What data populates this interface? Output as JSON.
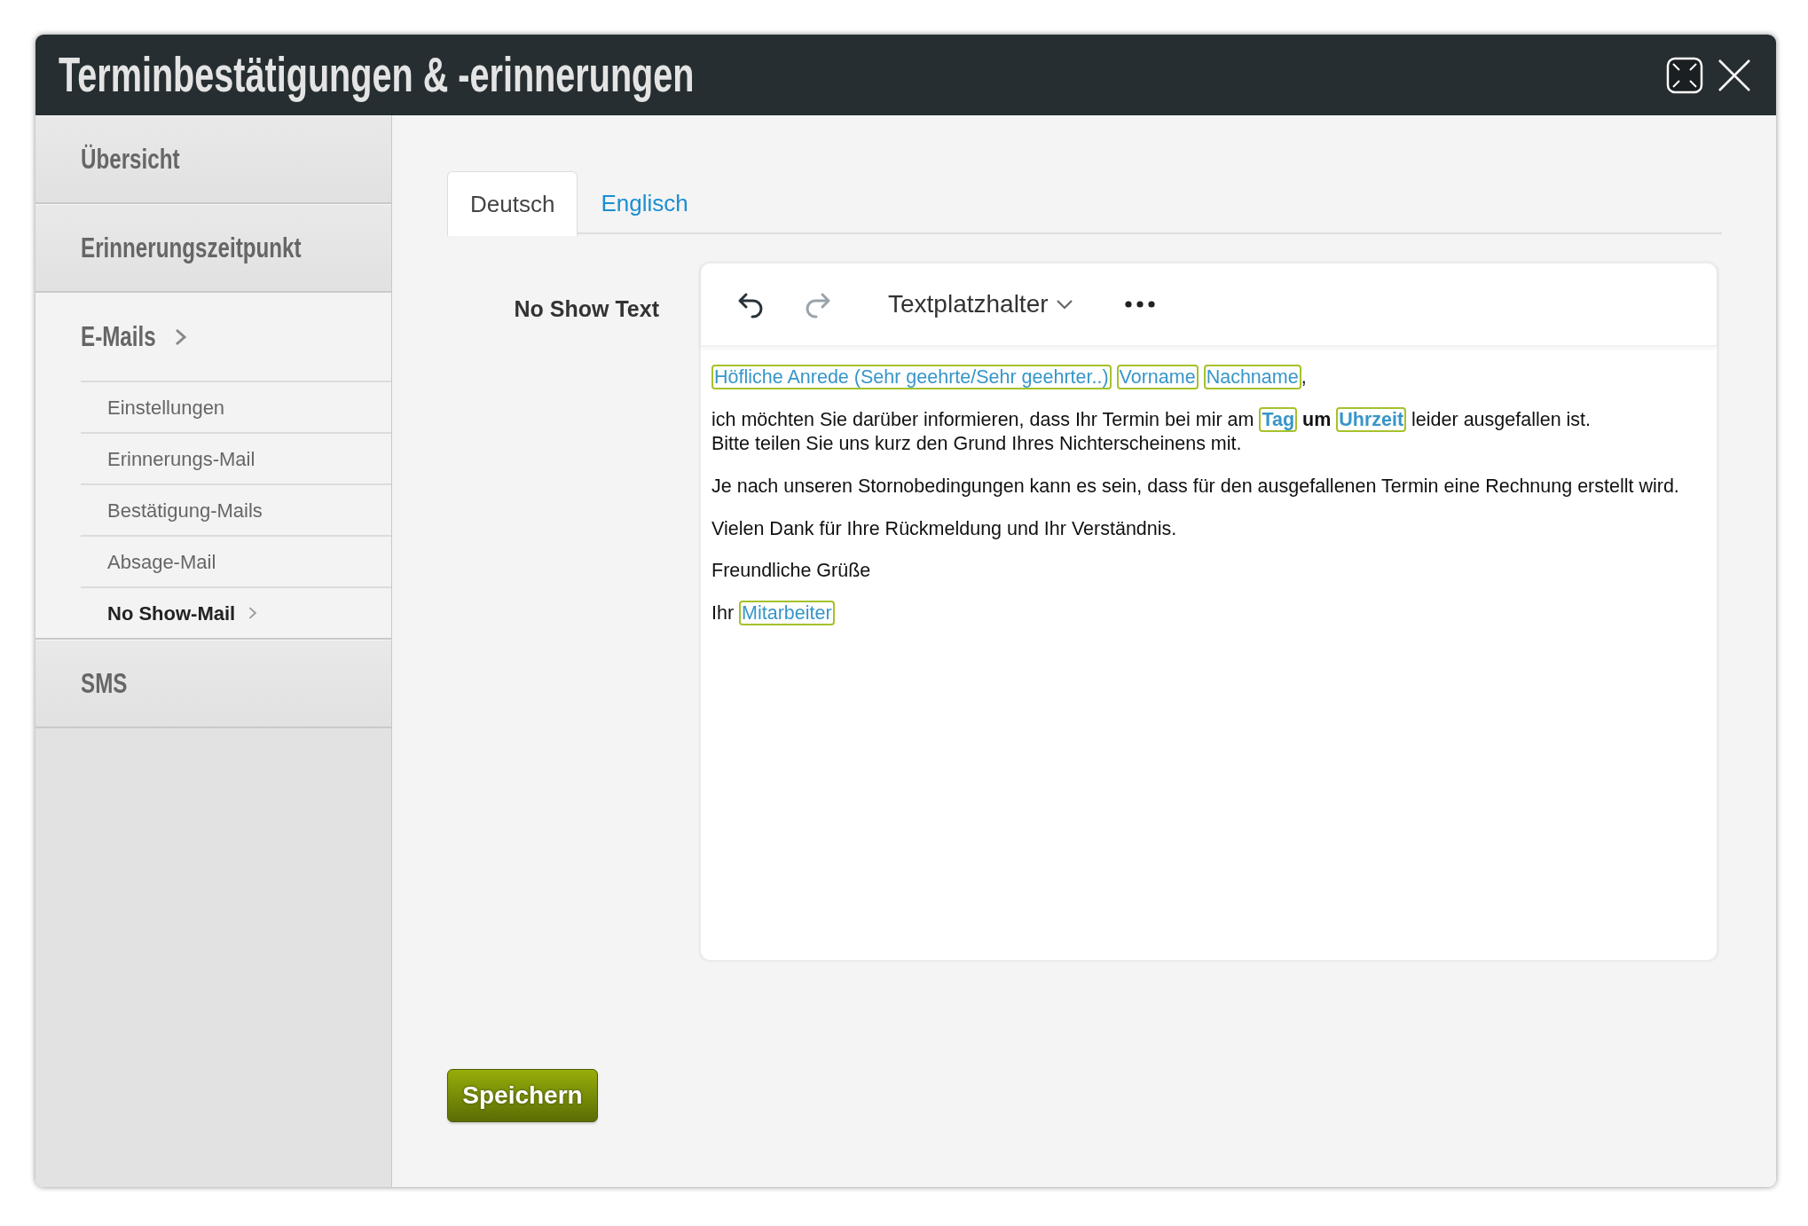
{
  "window": {
    "title": "Terminbestätigungen & -erinnerungen"
  },
  "sidebar": {
    "items": [
      {
        "label": "Übersicht",
        "expanded": false
      },
      {
        "label": "Erinnerungszeitpunkt",
        "expanded": false
      },
      {
        "label": "E-Mails",
        "expanded": true,
        "children": [
          {
            "label": "Einstellungen",
            "selected": false
          },
          {
            "label": "Erinnerungs-Mail",
            "selected": false
          },
          {
            "label": "Bestätigung-Mails",
            "selected": false
          },
          {
            "label": "Absage-Mail",
            "selected": false
          },
          {
            "label": "No Show-Mail",
            "selected": true
          }
        ]
      },
      {
        "label": "SMS",
        "expanded": false
      }
    ]
  },
  "tabs": [
    {
      "label": "Deutsch",
      "selected": true
    },
    {
      "label": "Englisch",
      "selected": false
    }
  ],
  "field": {
    "label": "No Show Text",
    "toolbar": {
      "undo": {
        "disabled": false
      },
      "redo": {
        "disabled": true
      },
      "dropdown": "Textplatzhalter"
    },
    "paragraphs": [
      {
        "segments": [
          {
            "kind": "placeholder",
            "text": "Höfliche Anrede (Sehr geehrte/Sehr geehrter..)",
            "bold": false
          },
          {
            "kind": "placeholder",
            "text": "Vorname",
            "bold": false
          },
          {
            "kind": "placeholder",
            "text": "Nachname",
            "bold": false
          },
          {
            "kind": "text",
            "text": ",",
            "bold": false
          }
        ]
      },
      {
        "segments": [
          {
            "kind": "text",
            "text": "ich möchten Sie darüber informieren, dass Ihr Termin bei mir am ",
            "bold": false
          },
          {
            "kind": "placeholder",
            "text": "Tag",
            "bold": true
          },
          {
            "kind": "text",
            "text": " um ",
            "bold": true
          },
          {
            "kind": "placeholder",
            "text": "Uhrzeit",
            "bold": true
          },
          {
            "kind": "text",
            "text": " leider ausgefallen ist.",
            "bold": false
          },
          {
            "kind": "break"
          },
          {
            "kind": "text",
            "text": "Bitte teilen Sie uns kurz den Grund Ihres Nichterscheinens mit.",
            "bold": false
          }
        ]
      },
      {
        "segments": [
          {
            "kind": "text",
            "text": "Je nach unseren Stornobedingungen kann es sein, dass für den ausgefallenen Termin eine Rechnung erstellt wird.",
            "bold": false
          }
        ]
      },
      {
        "segments": [
          {
            "kind": "text",
            "text": "Vielen Dank für Ihre Rückmeldung und Ihr Verständnis.",
            "bold": false
          }
        ]
      },
      {
        "segments": [
          {
            "kind": "text",
            "text": "Freundliche Grüße",
            "bold": false
          }
        ]
      },
      {
        "segments": [
          {
            "kind": "text",
            "text": "Ihr ",
            "bold": false
          },
          {
            "kind": "placeholder",
            "text": "Mitarbeiter",
            "bold": false
          }
        ]
      }
    ]
  },
  "save_button": "Speichern"
}
